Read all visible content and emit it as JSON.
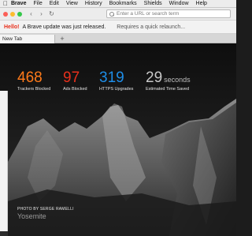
{
  "menubar": {
    "app_name": "Brave",
    "items": [
      "File",
      "Edit",
      "View",
      "History",
      "Bookmarks",
      "Shields",
      "Window",
      "Help"
    ]
  },
  "toolbar": {
    "back_icon": "back-arrow",
    "forward_icon": "forward-arrow",
    "reload_icon": "reload",
    "url_placeholder": "Enter a URL or search term"
  },
  "notice": {
    "hello": "Hello!",
    "message": "A Brave update was just released.",
    "relaunch": "Requires a quick relaunch..."
  },
  "tabs": {
    "active_label": "New Tab",
    "new_tab_symbol": "+"
  },
  "stats": {
    "trackers": {
      "value": "468",
      "label": "Trackers Blocked",
      "color": "#ff7a1a"
    },
    "ads": {
      "value": "97",
      "label": "Ads Blocked",
      "color": "#e8301c"
    },
    "https": {
      "value": "319",
      "label": "HTTPS Upgrades",
      "color": "#1e8ee8"
    },
    "time": {
      "value": "29",
      "unit": "seconds",
      "label": "Estimated Time Saved",
      "color": "#c8c8c8"
    }
  },
  "photo": {
    "credit": "PHOTO BY SERGE RAMELLI",
    "location": "Yosemite"
  }
}
